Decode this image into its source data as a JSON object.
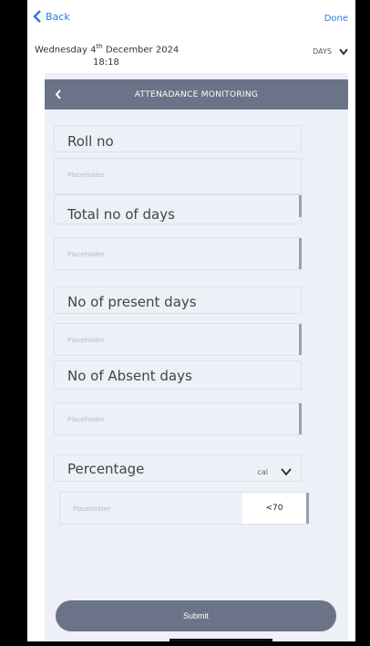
{
  "topbar": {
    "back_label": "Back",
    "done_label": "Done"
  },
  "date": {
    "weekday_day": "Wednesday 4",
    "suffix": "th",
    "month_year": "December 2024",
    "time": "18:18"
  },
  "period": {
    "value": "DAYS"
  },
  "header": {
    "title": "ATTENADANCE MONITORING"
  },
  "form": {
    "roll_no": {
      "label": "Roll no",
      "placeholder": "Placeholder"
    },
    "total_days": {
      "label": "Total no of days",
      "placeholder": "Placeholder"
    },
    "present_days": {
      "label": "No of present days",
      "placeholder": "Placeholder"
    },
    "absent_days": {
      "label": "No of Absent days",
      "placeholder": "Placeholder"
    },
    "percentage": {
      "label": "Percentage",
      "calc": "cal",
      "placeholder": "Placeholder",
      "threshold": "<70"
    }
  },
  "submit_label": "Submit",
  "colors": {
    "accent": "#2f7ad9",
    "header_bg": "#6a7387",
    "panel_bg": "#edf0f7"
  }
}
